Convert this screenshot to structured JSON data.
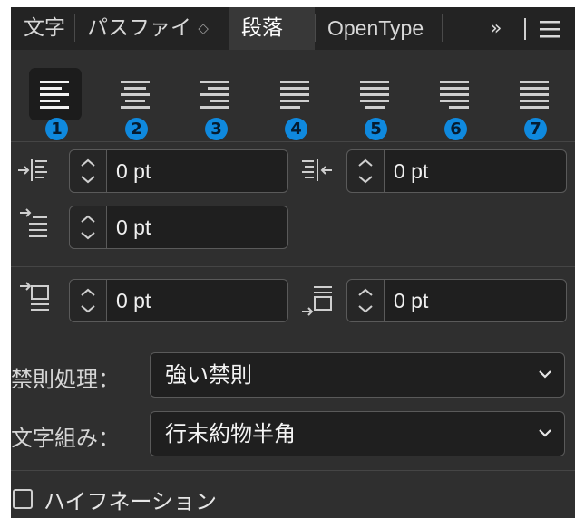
{
  "tabs": {
    "items": [
      {
        "label": "文字",
        "active": false
      },
      {
        "label": "パスファイ",
        "active": false
      },
      {
        "label": "段落",
        "active": true
      },
      {
        "label": "OpenType",
        "active": false
      }
    ],
    "overflow_label": "»",
    "menu_icon": "hamburger-menu-icon"
  },
  "alignment": {
    "buttons": [
      {
        "name": "align-left",
        "number": "1",
        "selected": true
      },
      {
        "name": "align-center",
        "number": "2",
        "selected": false
      },
      {
        "name": "align-right",
        "number": "3",
        "selected": false
      },
      {
        "name": "justify-last-left",
        "number": "4",
        "selected": false
      },
      {
        "name": "justify-last-center",
        "number": "5",
        "selected": false
      },
      {
        "name": "justify-last-right",
        "number": "6",
        "selected": false
      },
      {
        "name": "justify-all",
        "number": "7",
        "selected": false
      }
    ],
    "number_color": "#0f89de"
  },
  "indent": {
    "left_indent": "0 pt",
    "right_indent": "0 pt",
    "first_line_indent": "0 pt"
  },
  "spacing": {
    "space_before": "0 pt",
    "space_after": "0 pt"
  },
  "kinsoku": {
    "label": "禁則処理：",
    "value": "強い禁則"
  },
  "mojikumi": {
    "label": "文字組み：",
    "value": "行末約物半角"
  },
  "hyphenation": {
    "label": "ハイフネーション",
    "checked": false
  }
}
